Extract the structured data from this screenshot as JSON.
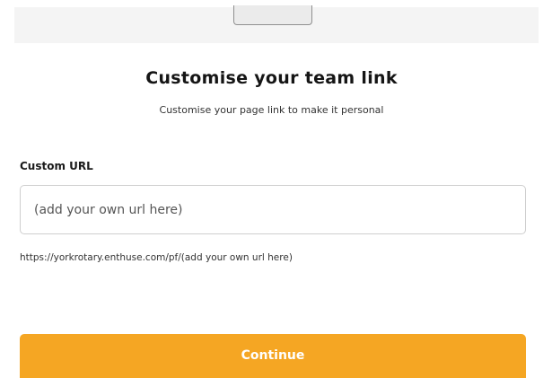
{
  "header": {
    "title": "Customise your team link",
    "subtitle": "Customise your page link to make it personal"
  },
  "form": {
    "label": "Custom URL",
    "input_value": "",
    "input_placeholder": "(add your own url here)",
    "url_preview": "https://yorkrotary.enthuse.com/pf/(add your own url here)"
  },
  "actions": {
    "continue_label": "Continue"
  },
  "colors": {
    "accent": "#f5a623",
    "top_band": "#f4f4f4"
  }
}
